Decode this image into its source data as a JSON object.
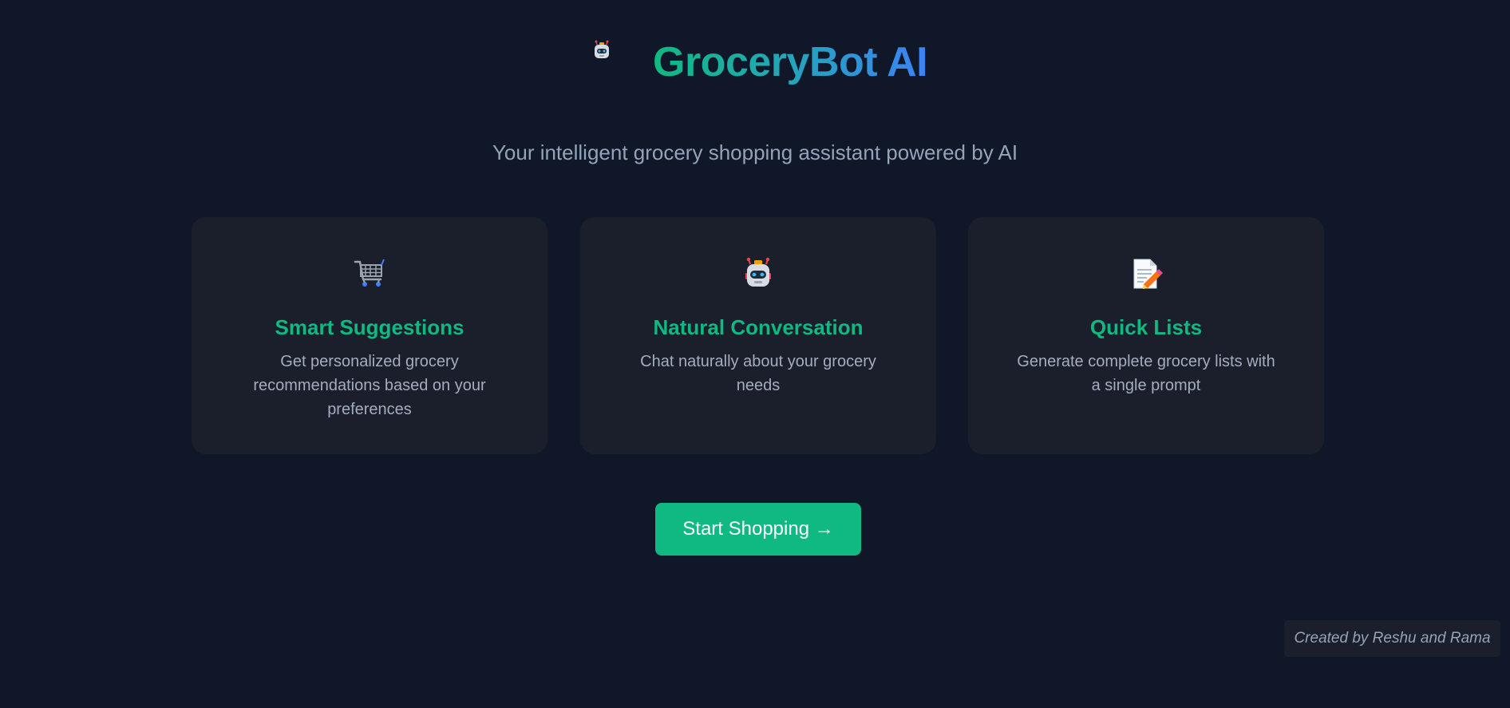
{
  "header": {
    "logo_icon": "robot-face-icon",
    "title": "GroceryBot AI",
    "tagline": "Your intelligent grocery shopping assistant powered by AI"
  },
  "features": [
    {
      "icon": "shopping-cart-icon",
      "title": "Smart Suggestions",
      "description": "Get personalized grocery recommendations based on your preferences"
    },
    {
      "icon": "robot-face-icon",
      "title": "Natural Conversation",
      "description": "Chat naturally about your grocery needs"
    },
    {
      "icon": "memo-icon",
      "title": "Quick Lists",
      "description": "Generate complete grocery lists with a single prompt"
    }
  ],
  "cta": {
    "label": "Start Shopping →"
  },
  "footer": {
    "credit": "Created by Reshu and Rama"
  },
  "colors": {
    "background": "#0f1729",
    "card_background": "#1a1f2b",
    "accent_green": "#10b981",
    "accent_blue": "#3b82f6",
    "muted_text": "#94a3b8"
  }
}
